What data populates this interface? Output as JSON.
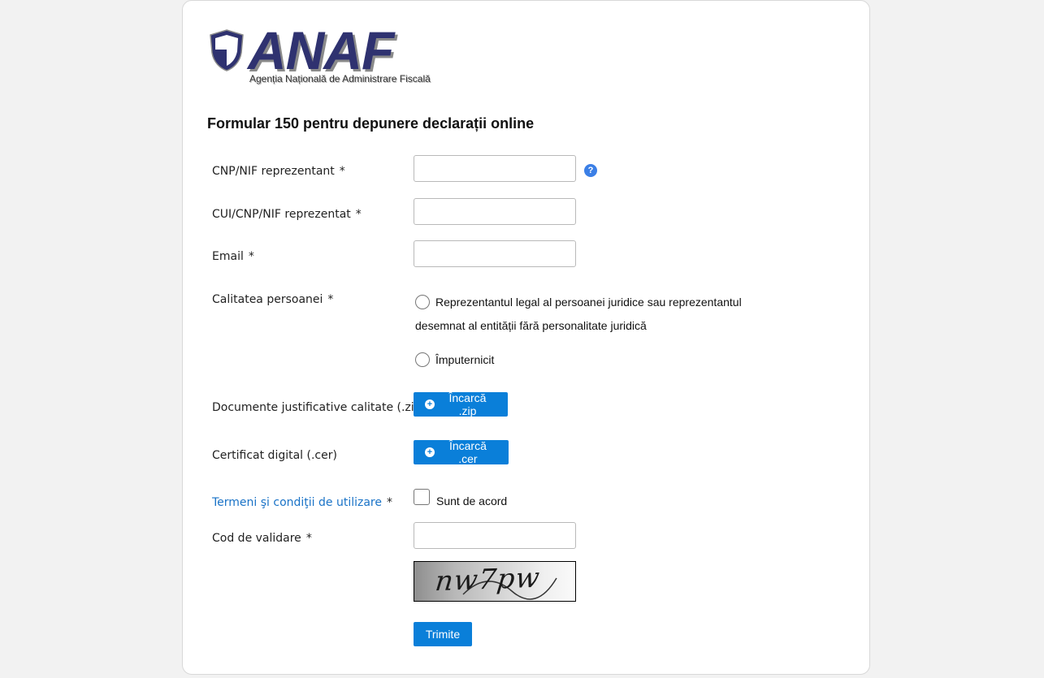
{
  "logo": {
    "name": "ANAF",
    "subtitle": "Agenția Națională de Administrare Fiscală"
  },
  "form": {
    "title": "Formular 150 pentru depunere declarații online",
    "required_mark": "*",
    "fields": {
      "cnp_reprezentant": {
        "label": "CNP/NIF reprezentant",
        "value": ""
      },
      "cui_reprezentat": {
        "label": "CUI/CNP/NIF reprezentat",
        "value": ""
      },
      "email": {
        "label": "Email",
        "value": ""
      },
      "calitatea": {
        "label": "Calitatea persoanei",
        "options": [
          {
            "line1": "Reprezentantul legal al persoanei juridice sau reprezentantul",
            "line2": "desemnat al entității fără personalitate juridică"
          },
          {
            "line1": "Împuternicit"
          }
        ]
      },
      "documente": {
        "label": "Documente justificative calitate (.zip)",
        "button": "Încarcă .zip"
      },
      "certificat": {
        "label": "Certificat digital (.cer)",
        "button": "Încarcă .cer"
      },
      "termeni": {
        "link": "Termeni şi condiţii de utilizare",
        "checkbox_label": "Sunt de acord"
      },
      "cod": {
        "label": "Cod de validare",
        "value": "",
        "captcha_text": "nw7pw"
      }
    },
    "submit": "Trimite"
  },
  "colors": {
    "primary": "#0a7fd9",
    "link": "#1a73c7",
    "logo": "#2f3270",
    "help": "#3b7fe6"
  },
  "icons": {
    "help": "help-icon",
    "upload": "plus-circle-icon",
    "shield": "shield-icon"
  }
}
